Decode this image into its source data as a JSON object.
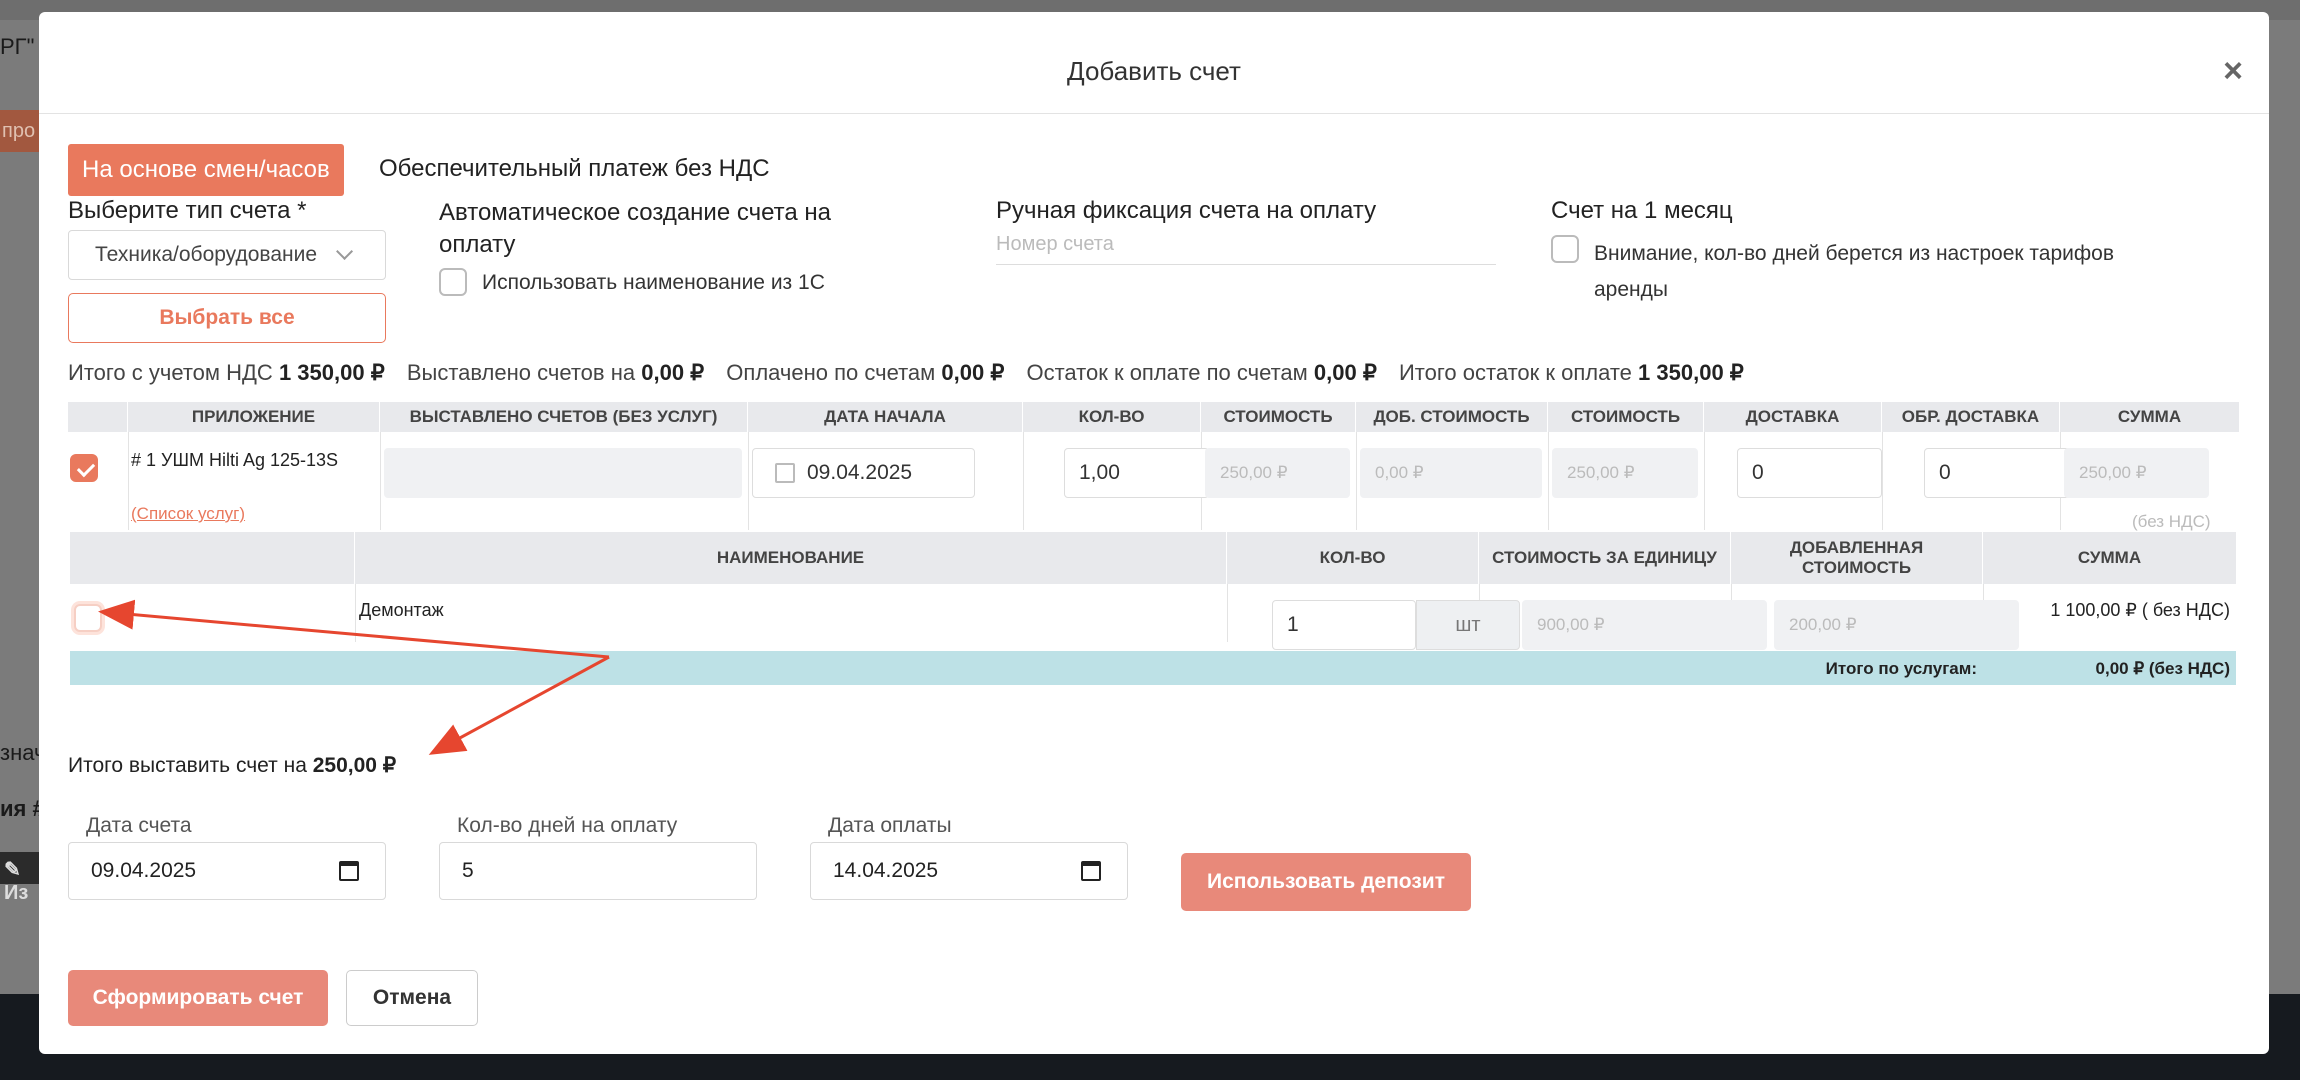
{
  "background": {
    "frag1": "РГ\" (",
    "frag2": "про",
    "frag3": "знач",
    "frag4": "ия #",
    "frag5": "Из"
  },
  "modal": {
    "title": "Добавить счет",
    "close": "×"
  },
  "header_row": {
    "tag_button": "На основе смен/часов",
    "tag_caption": "Обеспечительный платеж без НДС"
  },
  "type_select": {
    "label": "Выберите тип счета *",
    "value": "Техника/оборудование",
    "select_all": "Выбрать все"
  },
  "auto_create": {
    "label": "Автоматическое создание счета на оплату",
    "checkbox_label": "Использовать наименование из 1С"
  },
  "manual_fix": {
    "label": "Ручная фиксация счета на оплату",
    "placeholder": "Номер счета"
  },
  "month_invoice": {
    "label": "Счет на 1 месяц",
    "checkbox_label": "Внимание, кол-во дней берется из настроек тарифов аренды"
  },
  "totals": {
    "vat_label": "Итого с учетом НДС",
    "vat_value": "1 350,00 ₽",
    "issued_label": "Выставлено счетов на",
    "issued_value": "0,00 ₽",
    "paid_label": "Оплачено по счетам",
    "paid_value": "0,00 ₽",
    "remaining_label": "Остаток к оплате по счетам",
    "remaining_value": "0,00 ₽",
    "total_remaining_label": "Итого остаток к оплате",
    "total_remaining_value": "1 350,00 ₽"
  },
  "main_table": {
    "headers": [
      "ПРИЛОЖЕНИЕ",
      "ВЫСТАВЛЕНО СЧЕТОВ (БЕЗ УСЛУГ)",
      "ДАТА НАЧАЛА",
      "КОЛ-ВО",
      "СТОИМОСТЬ",
      "ДОБ. СТОИМОСТЬ",
      "СТОИМОСТЬ",
      "ДОСТАВКА",
      "ОБР. ДОСТАВКА",
      "СУММА"
    ],
    "row": {
      "item": "# 1 УШМ Hilti Ag 125-13S",
      "services_link": "(Список услуг)",
      "start_date": "09.04.2025",
      "qty": "1,00",
      "cost": "250,00 ₽",
      "add_cost": "0,00 ₽",
      "cost2": "250,00 ₽",
      "delivery": "0",
      "return_delivery": "0",
      "sum": "250,00 ₽",
      "sum_note": "(без НДС)"
    }
  },
  "services_table": {
    "headers": [
      "НАИМЕНОВАНИЕ",
      "КОЛ-ВО",
      "СТОИМОСТЬ ЗА ЕДИНИЦУ",
      "ДОБАВЛЕННАЯ СТОИМОСТЬ",
      "СУММА"
    ],
    "row": {
      "name": "Демонтаж",
      "qty": "1",
      "unit": "шт",
      "unit_cost": "900,00 ₽",
      "added_cost": "200,00 ₽",
      "sum": "1 100,00 ₽ ( без НДС)"
    },
    "total_label": "Итого по услугам:",
    "total_value": "0,00 ₽ (без НДС)"
  },
  "invoice_total": {
    "label": "Итого выставить счет на",
    "value": "250,00 ₽"
  },
  "form": {
    "invoice_date_label": "Дата счета",
    "invoice_date": "09.04.2025",
    "days_label": "Кол-во дней на оплату",
    "days": "5",
    "pay_date_label": "Дата оплаты",
    "pay_date": "14.04.2025",
    "deposit_button": "Использовать депозит"
  },
  "footer": {
    "submit": "Сформировать счет",
    "cancel": "Отмена"
  },
  "colors": {
    "accent": "#e9795d",
    "arrow": "#e6462f",
    "services_total_bg": "#bde1e6"
  }
}
